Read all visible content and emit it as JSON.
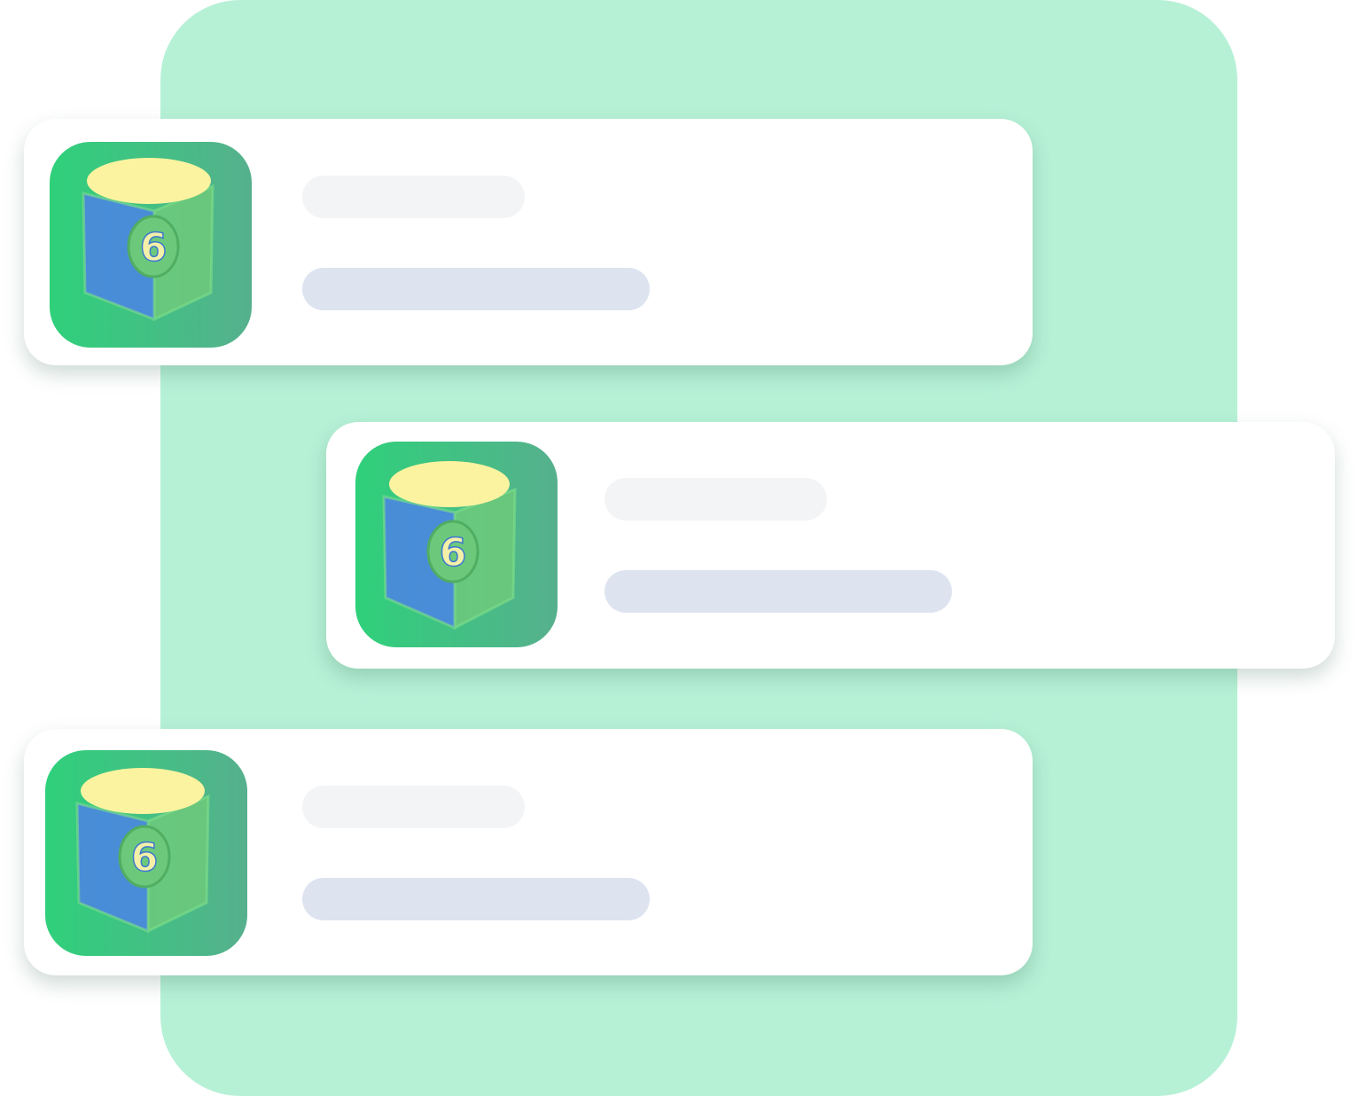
{
  "colors": {
    "backdrop": "#b6f1d6",
    "card": "#ffffff",
    "title_placeholder": "#f3f4f6",
    "subtitle_placeholder": "#dde4f0",
    "icon_gradient_start": "#2fd07b",
    "icon_gradient_end": "#56b08d",
    "icon_top": "#fcf3a0",
    "icon_left_face": "#4a86e0",
    "icon_right_face": "#6cc97c",
    "icon_glyph": "#f5f0a8"
  },
  "icons": {
    "app_icon": "hand-drawn-cube-app-icon"
  },
  "list": {
    "items": [
      {
        "icon": "hand-drawn-cube-app-icon",
        "glyph": "6"
      },
      {
        "icon": "hand-drawn-cube-app-icon",
        "glyph": "6"
      },
      {
        "icon": "hand-drawn-cube-app-icon",
        "glyph": "6"
      }
    ]
  }
}
